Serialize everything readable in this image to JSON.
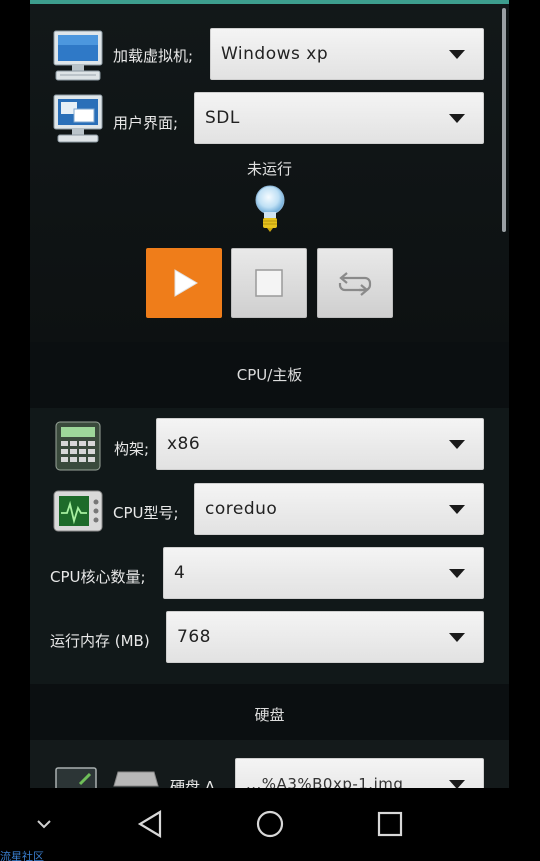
{
  "vm": {
    "label": "加载虚拟机;",
    "value": "Windows xp"
  },
  "ui": {
    "label": "用户界面;",
    "value": "SDL"
  },
  "status": {
    "text": "未运行"
  },
  "controls": {
    "play_color": "#ef7d1a"
  },
  "cpu_section": {
    "title": "CPU/主板",
    "arch": {
      "label": "构架;",
      "value": "x86"
    },
    "model": {
      "label": "CPU型号;",
      "value": "coreduo"
    },
    "cores": {
      "label": "CPU核心数量;",
      "value": "4"
    },
    "memory": {
      "label": "运行内存 (MB)",
      "value": "768"
    }
  },
  "disk_section": {
    "title": "硬盘",
    "hda": {
      "label": "硬盘 A",
      "value": "...%A3%B0xp-1.img"
    }
  },
  "watermark": "流星社区",
  "colors": {
    "accent": "#3d9e8e",
    "background": "#0e1215"
  }
}
